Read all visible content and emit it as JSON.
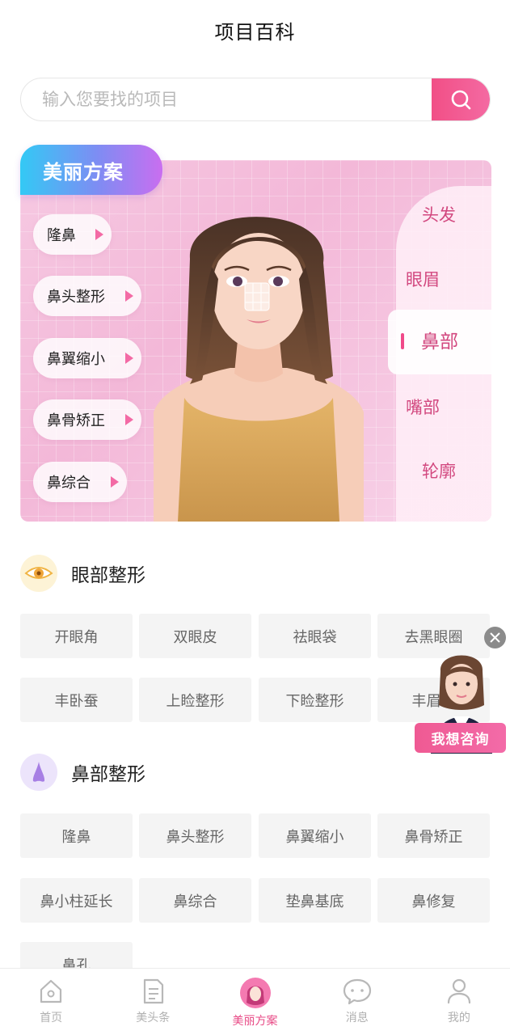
{
  "header": {
    "title": "项目百科"
  },
  "search": {
    "placeholder": "输入您要找的项目",
    "value": ""
  },
  "banner": {
    "tag": "美丽方案",
    "procedures": [
      "隆鼻",
      "鼻头整形",
      "鼻翼缩小",
      "鼻骨矫正",
      "鼻综合"
    ],
    "parts": [
      "头发",
      "眼眉",
      "鼻部",
      "嘴部",
      "轮廓"
    ],
    "active_part": "鼻部"
  },
  "sections": [
    {
      "title": "眼部整形",
      "icon": "eye-icon",
      "tags": [
        "开眼角",
        "双眼皮",
        "祛眼袋",
        "去黑眼圈",
        "丰卧蚕",
        "上睑整形",
        "下睑整形",
        "丰眉弓"
      ]
    },
    {
      "title": "鼻部整形",
      "icon": "nose-icon",
      "tags": [
        "隆鼻",
        "鼻头整形",
        "鼻翼缩小",
        "鼻骨矫正",
        "鼻小柱延长",
        "鼻综合",
        "垫鼻基底",
        "鼻修复",
        "鼻孔"
      ]
    }
  ],
  "consult": {
    "label": "我想咨询"
  },
  "bottom_nav": [
    {
      "label": "首页",
      "icon": "home-icon"
    },
    {
      "label": "美头条",
      "icon": "document-icon"
    },
    {
      "label": "美丽方案",
      "icon": "beauty-avatar-icon",
      "active": true
    },
    {
      "label": "消息",
      "icon": "chat-icon"
    },
    {
      "label": "我的",
      "icon": "profile-icon"
    }
  ],
  "colors": {
    "accent": "#f04a89",
    "tag_bg": "#f4f4f4",
    "banner_tag_start": "#33c9f5",
    "banner_tag_end": "#c96ef0"
  }
}
